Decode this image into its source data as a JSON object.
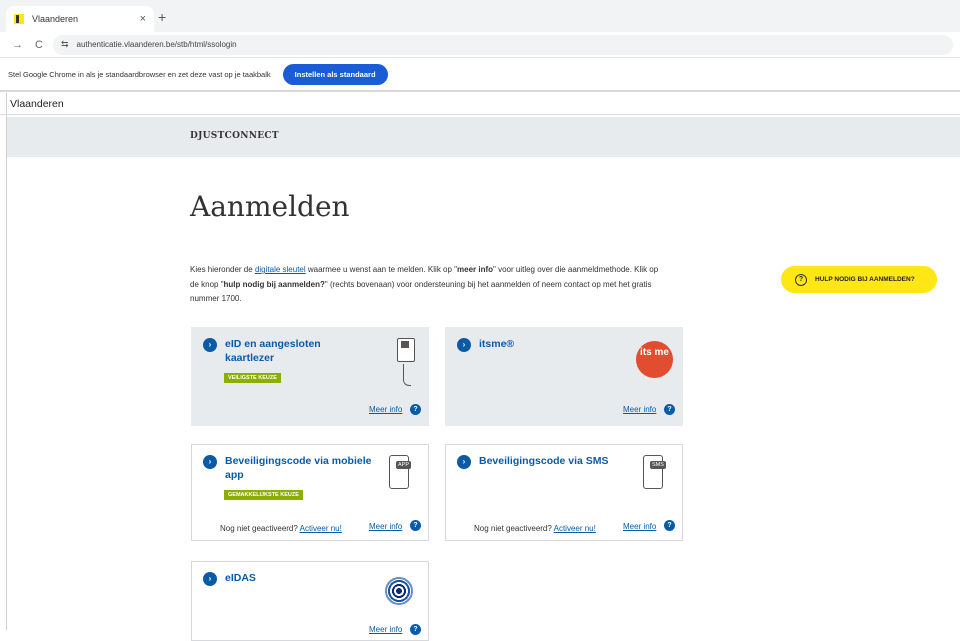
{
  "browser": {
    "tab_title": "Vlaanderen",
    "tab_close": "×",
    "new_tab": "+",
    "back": "→",
    "reload": "C",
    "url": "authenticatie.vlaanderen.be/stb/html/ssologin"
  },
  "infobar": {
    "message": "Stel Google Chrome in als je standaardbrowser en zet deze vast op je taakbalk",
    "button": "Instellen als standaard"
  },
  "site": {
    "brand": "Vlaanderen",
    "service": "DJUSTCONNECT"
  },
  "main": {
    "title": "Aanmelden",
    "intro": {
      "p1": "Kies hieronder de ",
      "link": "digitale sleutel",
      "p2": " waarmee u wenst aan te melden. Klik op \"",
      "b1": "meer info",
      "p3": "\" voor uitleg over die aanmeldmethode. Klik op de knop \"",
      "b2": "hulp nodig bij aanmelden?",
      "p4": "\" (rechts bovenaan) voor ondersteuning bij het aanmelden of neem contact op met het gratis nummer 1700."
    },
    "help_button": "HULP NODIG BIJ AANMELDEN?"
  },
  "cards": {
    "eid": {
      "title_line1": "eID en aangesloten",
      "title_line2": "kaartlezer",
      "badge": "VEILIGSTE KEUZE",
      "meer": "Meer info"
    },
    "itsme": {
      "title": "itsme®",
      "logo": "its me",
      "meer": "Meer info"
    },
    "app": {
      "title_line1": "Beveiligingscode via mobiele",
      "title_line2": "app",
      "badge": "GEMAKKELIJKSTE KEUZE",
      "icon_label": "APP",
      "nog": "Nog niet geactiveerd?",
      "activeer": "Activeer nu!",
      "meer": "Meer info"
    },
    "sms": {
      "title": "Beveiligingscode via SMS",
      "icon_label": "SMS",
      "nog": "Nog niet geactiveerd?",
      "activeer": "Activeer nu!",
      "meer": "Meer info"
    },
    "eidas": {
      "title": "eIDAS",
      "meer": "Meer info"
    }
  }
}
